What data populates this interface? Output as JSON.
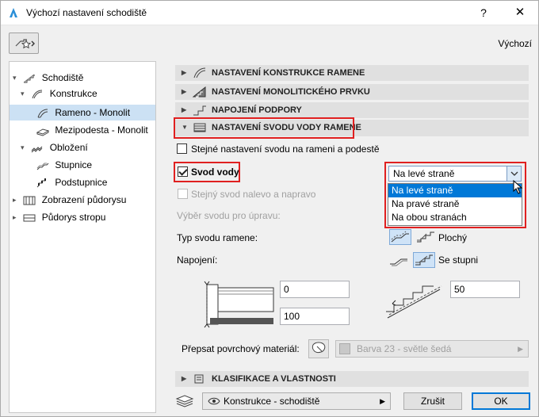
{
  "window": {
    "title": "Výchozí nastavení schodiště",
    "help_glyph": "?",
    "close_glyph": "✕",
    "default_label": "Výchozí"
  },
  "tree": {
    "items": [
      {
        "label": "Schodiště"
      },
      {
        "label": "Konstrukce"
      },
      {
        "label": "Rameno - Monolit"
      },
      {
        "label": "Mezipodesta - Monolit"
      },
      {
        "label": "Obložení"
      },
      {
        "label": "Stupnice"
      },
      {
        "label": "Podstupnice"
      },
      {
        "label": "Zobrazení půdorysu"
      },
      {
        "label": "Půdorys stropu"
      }
    ]
  },
  "sections": {
    "s1": "NASTAVENÍ KONSTRUKCE RAMENE",
    "s2": "NASTAVENÍ MONOLITICKÉHO PRVKU",
    "s3": "NAPOJENÍ PODPORY",
    "s4": "NASTAVENÍ SVODU VODY RAMENE",
    "s5": "KLASIFIKACE A VLASTNOSTI"
  },
  "drainage": {
    "same_settings_label": "Stejné nastavení svodu na rameni a podestě",
    "water_drain_label": "Svod vody",
    "same_drain_label": "Stejný svod nalevo a napravo",
    "select_drain_label": "Výběr svodu pro úpravu:",
    "side_select_value": "Na levé straně",
    "side_options": [
      "Na levé straně",
      "Na pravé straně",
      "Na obou stranách"
    ],
    "type_label": "Typ svodu ramene:",
    "type_value": "Plochý",
    "connection_label": "Napojení:",
    "connection_value": "Se stupni",
    "offset_top": "0",
    "offset_bottom": "100",
    "offset_right": "50",
    "override_material_label": "Přepsat povrchový materiál:",
    "material_value": "Barva 23 - světle šedá"
  },
  "footer": {
    "layer_value": "Konstrukce - schodiště",
    "cancel_label": "Zrušit",
    "ok_label": "OK"
  },
  "colors": {
    "highlight_red": "#e02020",
    "selection_blue": "#0078d7",
    "tree_selected": "#cce1f4"
  }
}
